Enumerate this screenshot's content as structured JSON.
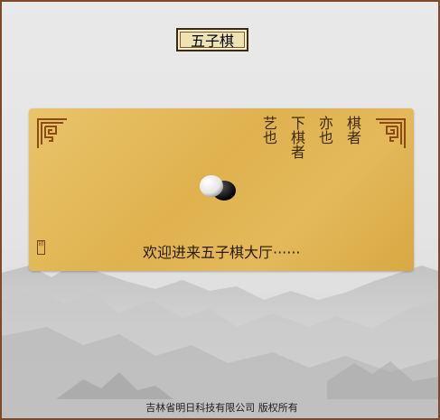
{
  "title": "五子棋",
  "motto": {
    "columns": [
      "棋者",
      "亦也",
      "下棋者",
      "艺也"
    ]
  },
  "welcome_text": "欢迎进来五子棋大厅······",
  "seal_text": "印",
  "footer": "吉林省明日科技有限公司 版权所有",
  "icons": {
    "piece": "go-stone-pair-icon",
    "corner_left": "fret-corner-ornament-icon",
    "corner_right": "fret-corner-ornament-icon",
    "background": "ink-mountains"
  },
  "colors": {
    "frame": "#7a4a2a",
    "board": "#e3b95a",
    "text": "#3d2a0e"
  }
}
